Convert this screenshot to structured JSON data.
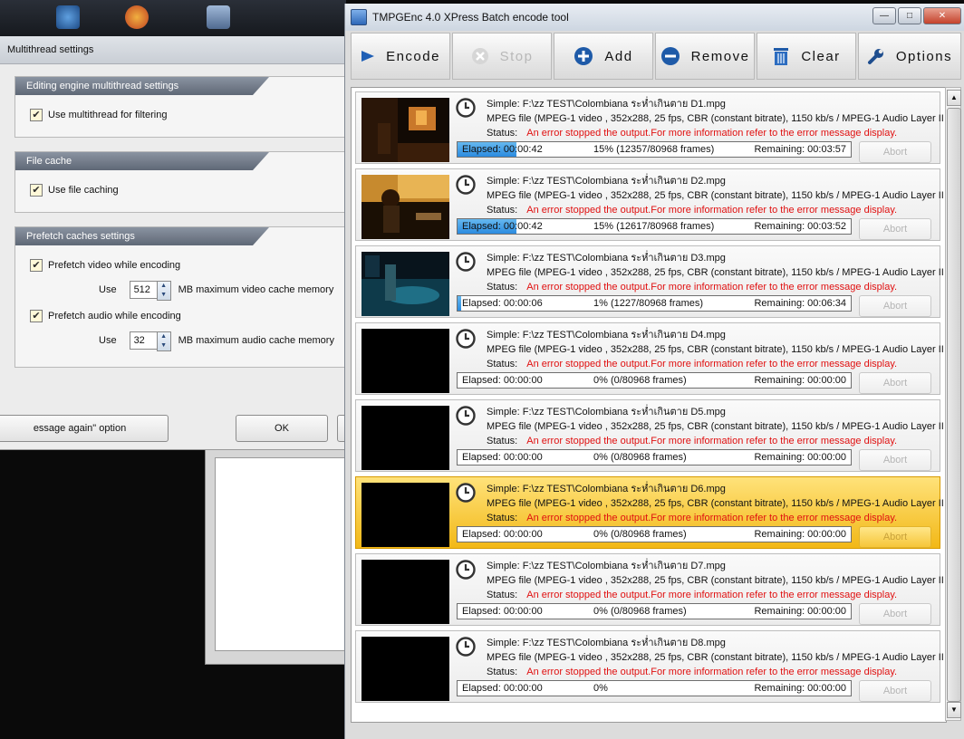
{
  "colors": {
    "error_red": "#e01010",
    "progress_blue": "#2b8be0",
    "selected_row": "#f2b817",
    "group_header": "#6b7482"
  },
  "mt_dialog": {
    "title": "Multithread settings",
    "groups": [
      {
        "header": "Editing engine multithread settings",
        "options": [
          {
            "label": "Use multithread for filtering",
            "checked": true
          }
        ]
      },
      {
        "header": "File cache",
        "options": [
          {
            "label": "Use file caching",
            "checked": true
          }
        ]
      },
      {
        "header": "Prefetch caches settings",
        "options": [
          {
            "label": "Prefetch video while encoding",
            "checked": true,
            "use_label": "Use",
            "value": "512",
            "unit": "MB maximum video cache memory"
          },
          {
            "label": "Prefetch audio while encoding",
            "checked": true,
            "use_label": "Use",
            "value": "32",
            "unit": "MB maximum audio cache memory"
          }
        ]
      }
    ],
    "message_option_label": "essage again\" option",
    "ok_label": "OK"
  },
  "batch_window": {
    "title": "TMPGEnc 4.0 XPress Batch encode tool",
    "toolbar": [
      {
        "label": "Encode",
        "icon": "play-icon",
        "enabled": true
      },
      {
        "label": "Stop",
        "icon": "stop-icon",
        "enabled": false
      },
      {
        "label": "Add",
        "icon": "add-icon",
        "enabled": true
      },
      {
        "label": "Remove",
        "icon": "remove-icon",
        "enabled": true
      },
      {
        "label": "Clear",
        "icon": "trash-icon",
        "enabled": true
      },
      {
        "label": "Options",
        "icon": "wrench-icon",
        "enabled": true
      }
    ],
    "abort_label": "Abort",
    "status_label": "Status:",
    "jobs": [
      {
        "title": "Simple: F:\\zz TEST\\Colombiana ระห่ำเกินตาย D1.mpg",
        "details": "MPEG file (MPEG-1 video , 352x288, 25 fps, CBR (constant bitrate), 1150 kb/s / MPEG-1 Audio Layer II",
        "status": "An error stopped the output.For more information refer to the error message display.",
        "elapsed": "Elapsed: 00:00:42",
        "percent": "15% (12357/80968  frames)",
        "remaining": "Remaining: 00:03:57",
        "progress": 0.15,
        "thumb": "scene1",
        "selected": false
      },
      {
        "title": "Simple: F:\\zz TEST\\Colombiana ระห่ำเกินตาย D2.mpg",
        "details": "MPEG file (MPEG-1 video , 352x288, 25 fps, CBR (constant bitrate), 1150 kb/s / MPEG-1 Audio Layer II",
        "status": "An error stopped the output.For more information refer to the error message display.",
        "elapsed": "Elapsed: 00:00:42",
        "percent": "15% (12617/80968  frames)",
        "remaining": "Remaining: 00:03:52",
        "progress": 0.15,
        "thumb": "scene2",
        "selected": false
      },
      {
        "title": "Simple: F:\\zz TEST\\Colombiana ระห่ำเกินตาย D3.mpg",
        "details": "MPEG file (MPEG-1 video , 352x288, 25 fps, CBR (constant bitrate), 1150 kb/s / MPEG-1 Audio Layer II",
        "status": "An error stopped the output.For more information refer to the error message display.",
        "elapsed": "Elapsed: 00:00:06",
        "percent": "1% (1227/80968  frames)",
        "remaining": "Remaining: 00:06:34",
        "progress": 0.01,
        "thumb": "scene3",
        "selected": false
      },
      {
        "title": "Simple: F:\\zz TEST\\Colombiana ระห่ำเกินตาย D4.mpg",
        "details": "MPEG file (MPEG-1 video , 352x288, 25 fps, CBR (constant bitrate), 1150 kb/s / MPEG-1 Audio Layer II",
        "status": "An error stopped the output.For more information refer to the error message display.",
        "elapsed": "Elapsed: 00:00:00",
        "percent": "0% (0/80968  frames)",
        "remaining": "Remaining: 00:00:00",
        "progress": 0,
        "thumb": "black",
        "selected": false
      },
      {
        "title": "Simple: F:\\zz TEST\\Colombiana ระห่ำเกินตาย D5.mpg",
        "details": "MPEG file (MPEG-1 video , 352x288, 25 fps, CBR (constant bitrate), 1150 kb/s / MPEG-1 Audio Layer II",
        "status": "An error stopped the output.For more information refer to the error message display.",
        "elapsed": "Elapsed: 00:00:00",
        "percent": "0% (0/80968  frames)",
        "remaining": "Remaining: 00:00:00",
        "progress": 0,
        "thumb": "black",
        "selected": false
      },
      {
        "title": "Simple: F:\\zz TEST\\Colombiana ระห่ำเกินตาย D6.mpg",
        "details": "MPEG file (MPEG-1 video , 352x288, 25 fps, CBR (constant bitrate), 1150 kb/s / MPEG-1 Audio Layer II",
        "status": "An error stopped the output.For more information refer to the error message display.",
        "elapsed": "Elapsed: 00:00:00",
        "percent": "0% (0/80968  frames)",
        "remaining": "Remaining: 00:00:00",
        "progress": 0,
        "thumb": "black",
        "selected": true
      },
      {
        "title": "Simple: F:\\zz TEST\\Colombiana ระห่ำเกินตาย D7.mpg",
        "details": "MPEG file (MPEG-1 video , 352x288, 25 fps, CBR (constant bitrate), 1150 kb/s / MPEG-1 Audio Layer II",
        "status": "An error stopped the output.For more information refer to the error message display.",
        "elapsed": "Elapsed: 00:00:00",
        "percent": "0% (0/80968  frames)",
        "remaining": "Remaining: 00:00:00",
        "progress": 0,
        "thumb": "black",
        "selected": false
      },
      {
        "title": "Simple: F:\\zz TEST\\Colombiana ระห่ำเกินตาย D8.mpg",
        "details": "MPEG file (MPEG-1 video , 352x288, 25 fps, CBR (constant bitrate), 1150 kb/s / MPEG-1 Audio Layer II",
        "status": "An error stopped the output.For more information refer to the error message display.",
        "elapsed": "Elapsed: 00:00:00",
        "percent": "0%",
        "remaining": "Remaining: 00:00:00",
        "progress": 0,
        "thumb": "black",
        "selected": false
      }
    ]
  }
}
